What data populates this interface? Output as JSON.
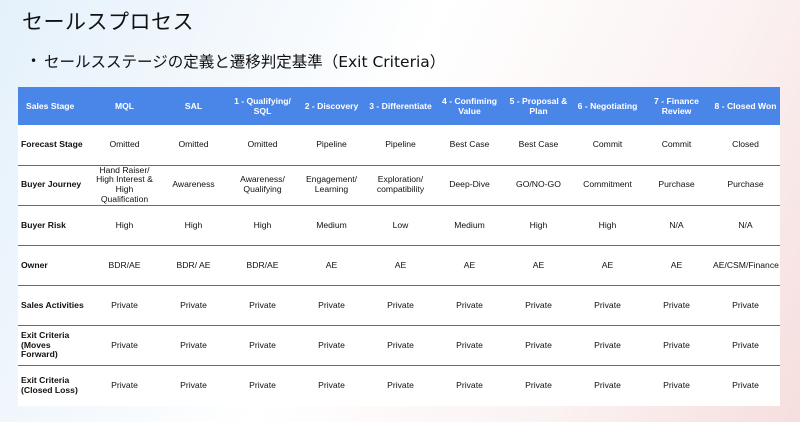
{
  "page": {
    "title": "セールスプロセス",
    "bullet": "•",
    "subtitle": "セールスステージの定義と遷移判定基準（Exit Criteria）"
  },
  "table": {
    "header": [
      "Sales Stage",
      "MQL",
      "SAL",
      "1 - Qualifying/ SQL",
      "2 - Discovery",
      "3 - Differentiate",
      "4 - Confiming Value",
      "5 - Proposal & Plan",
      "6 - Negotiating",
      "7 - Finance Review",
      "8 - Closed Won"
    ],
    "rows": [
      [
        "Forecast Stage",
        "Omitted",
        "Omitted",
        "Omitted",
        "Pipeline",
        "Pipeline",
        "Best Case",
        "Best Case",
        "Commit",
        "Commit",
        "Closed"
      ],
      [
        "Buyer Journey",
        "Hand Raiser/ High Interest & High Qualification",
        "Awareness",
        "Awareness/ Qualifying",
        "Engagement/ Learning",
        "Exploration/ compatibility",
        "Deep-Dive",
        "GO/NO-GO",
        "Commitment",
        "Purchase",
        "Purchase"
      ],
      [
        "Buyer Risk",
        "High",
        "High",
        "High",
        "Medium",
        "Low",
        "Medium",
        "High",
        "High",
        "N/A",
        "N/A"
      ],
      [
        "Owner",
        "BDR/AE",
        "BDR/ AE",
        "BDR/AE",
        "AE",
        "AE",
        "AE",
        "AE",
        "AE",
        "AE",
        "AE/CSM/Finance"
      ],
      [
        "Sales Activities",
        "Private",
        "Private",
        "Private",
        "Private",
        "Private",
        "Private",
        "Private",
        "Private",
        "Private",
        "Private"
      ],
      [
        "Exit Criteria (Moves Forward)",
        "Private",
        "Private",
        "Private",
        "Private",
        "Private",
        "Private",
        "Private",
        "Private",
        "Private",
        "Private"
      ],
      [
        "Exit Criteria (Closed Loss)",
        "Private",
        "Private",
        "Private",
        "Private",
        "Private",
        "Private",
        "Private",
        "Private",
        "Private",
        "Private"
      ]
    ]
  }
}
